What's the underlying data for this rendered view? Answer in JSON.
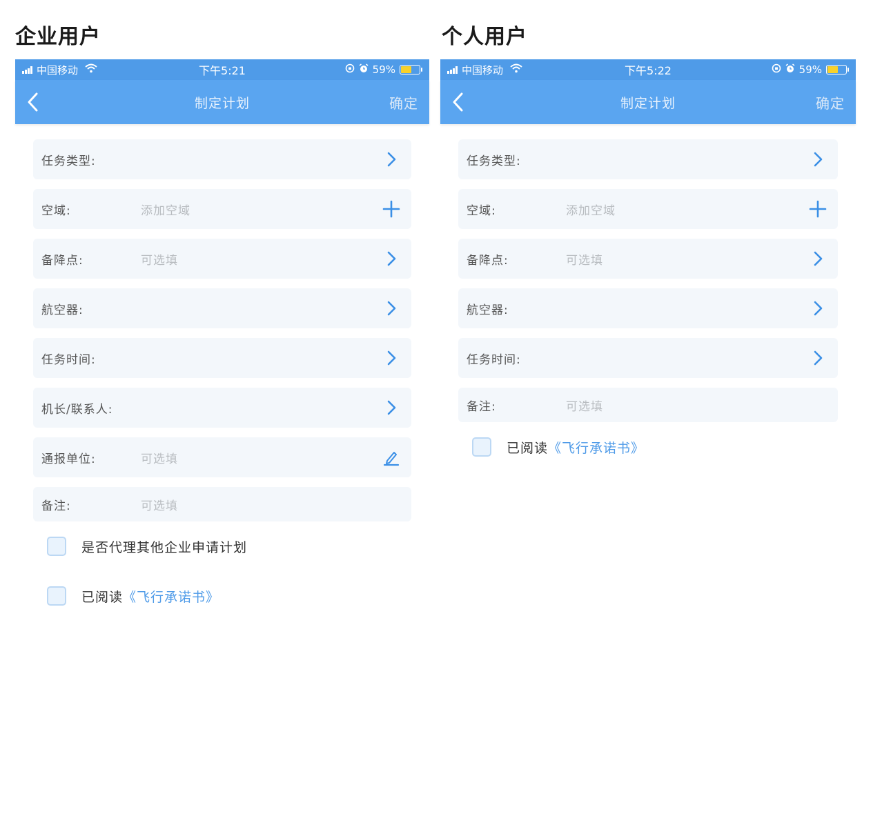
{
  "left": {
    "section_title": "企业用户",
    "status": {
      "carrier": "中国移动",
      "time": "下午5:21",
      "battery": "59%"
    },
    "nav": {
      "title": "制定计划",
      "confirm": "确定"
    },
    "rows": [
      {
        "label": "任务类型:",
        "value": "",
        "action": "chevron-right-icon"
      },
      {
        "label": "空域:",
        "value": "添加空域",
        "action": "plus-icon"
      },
      {
        "label": "备降点:",
        "value": "可选填",
        "action": "chevron-right-icon"
      },
      {
        "label": "航空器:",
        "value": "",
        "action": "chevron-right-icon"
      },
      {
        "label": "任务时间:",
        "value": "",
        "action": "chevron-right-icon"
      },
      {
        "label": "机长/联系人:",
        "value": "",
        "action": "chevron-right-icon"
      },
      {
        "label": "通报单位:",
        "value": "可选填",
        "action": "edit-icon"
      },
      {
        "label": "备注:",
        "value": "可选填",
        "action": ""
      }
    ],
    "checks": [
      {
        "text": "是否代理其他企业申请计划",
        "link": ""
      },
      {
        "text": "已阅读",
        "link": "《飞行承诺书》"
      }
    ]
  },
  "right": {
    "section_title": "个人用户",
    "status": {
      "carrier": "中国移动",
      "time": "下午5:22",
      "battery": "59%"
    },
    "nav": {
      "title": "制定计划",
      "confirm": "确定"
    },
    "rows": [
      {
        "label": "任务类型:",
        "value": "",
        "action": "chevron-right-icon"
      },
      {
        "label": "空域:",
        "value": "添加空域",
        "action": "plus-icon"
      },
      {
        "label": "备降点:",
        "value": "可选填",
        "action": "chevron-right-icon"
      },
      {
        "label": "航空器:",
        "value": "",
        "action": "chevron-right-icon"
      },
      {
        "label": "任务时间:",
        "value": "",
        "action": "chevron-right-icon"
      },
      {
        "label": "备注:",
        "value": "可选填",
        "action": ""
      }
    ],
    "checks": [
      {
        "text": "已阅读",
        "link": "《飞行承诺书》"
      }
    ]
  },
  "colors": {
    "primary": "#5aa5f0",
    "statusbar": "#4f9be8",
    "row_bg": "#f3f7fb",
    "accent": "#4f9be8"
  }
}
